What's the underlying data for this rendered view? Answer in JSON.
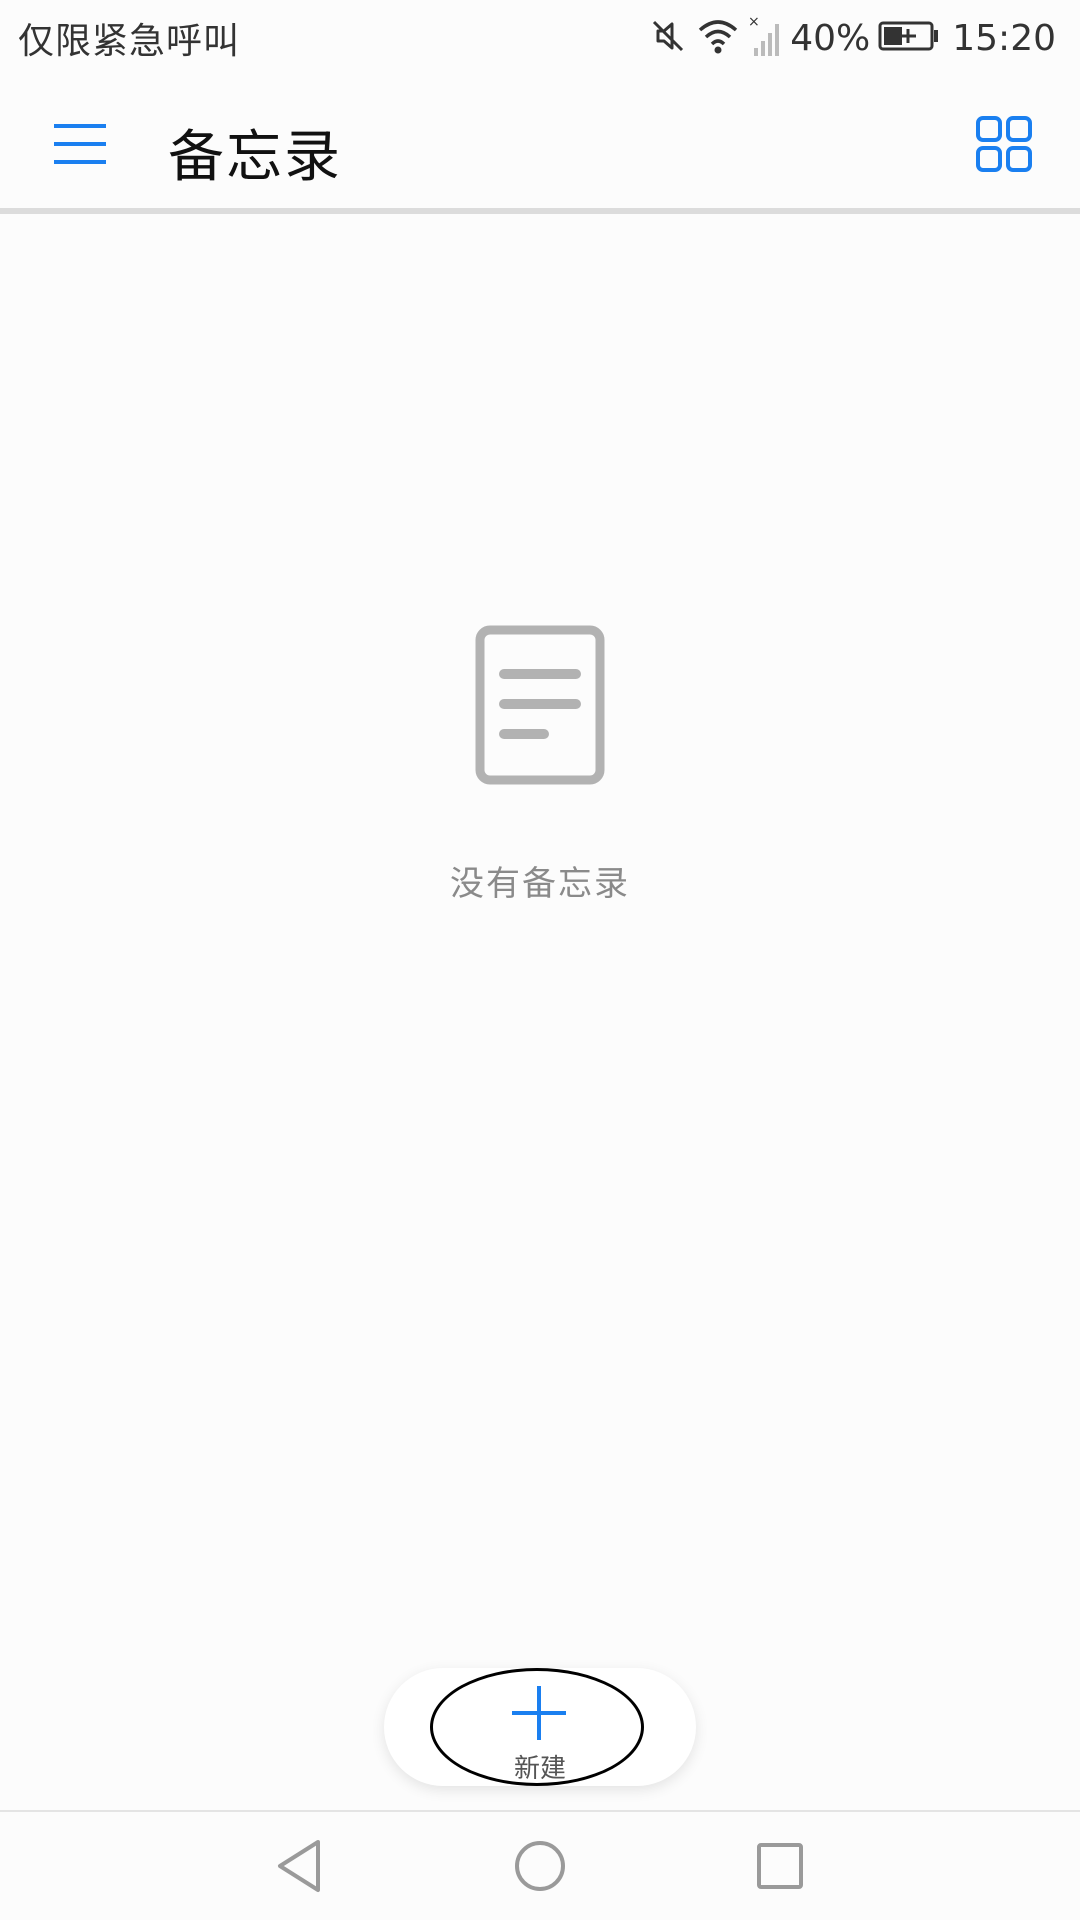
{
  "status_bar": {
    "carrier_text": "仅限紧急呼叫",
    "battery_percent": "40%",
    "time": "15:20",
    "icons": [
      "mute-icon",
      "wifi-icon",
      "no-signal-icon",
      "battery-charging-icon"
    ]
  },
  "app_bar": {
    "title": "备忘录",
    "menu_icon": "hamburger-menu-icon",
    "view_toggle_icon": "grid-view-icon"
  },
  "empty_state": {
    "icon": "note-document-icon",
    "message": "没有备忘录"
  },
  "fab": {
    "icon": "plus-icon",
    "label": "新建"
  },
  "nav_bar": {
    "icons": [
      "back-triangle-icon",
      "home-circle-icon",
      "recents-square-icon"
    ]
  },
  "colors": {
    "accent": "#1a7ff0",
    "background": "#fcfcfc",
    "empty_icon": "#b2b2b2",
    "empty_text": "#8a8a8a"
  }
}
